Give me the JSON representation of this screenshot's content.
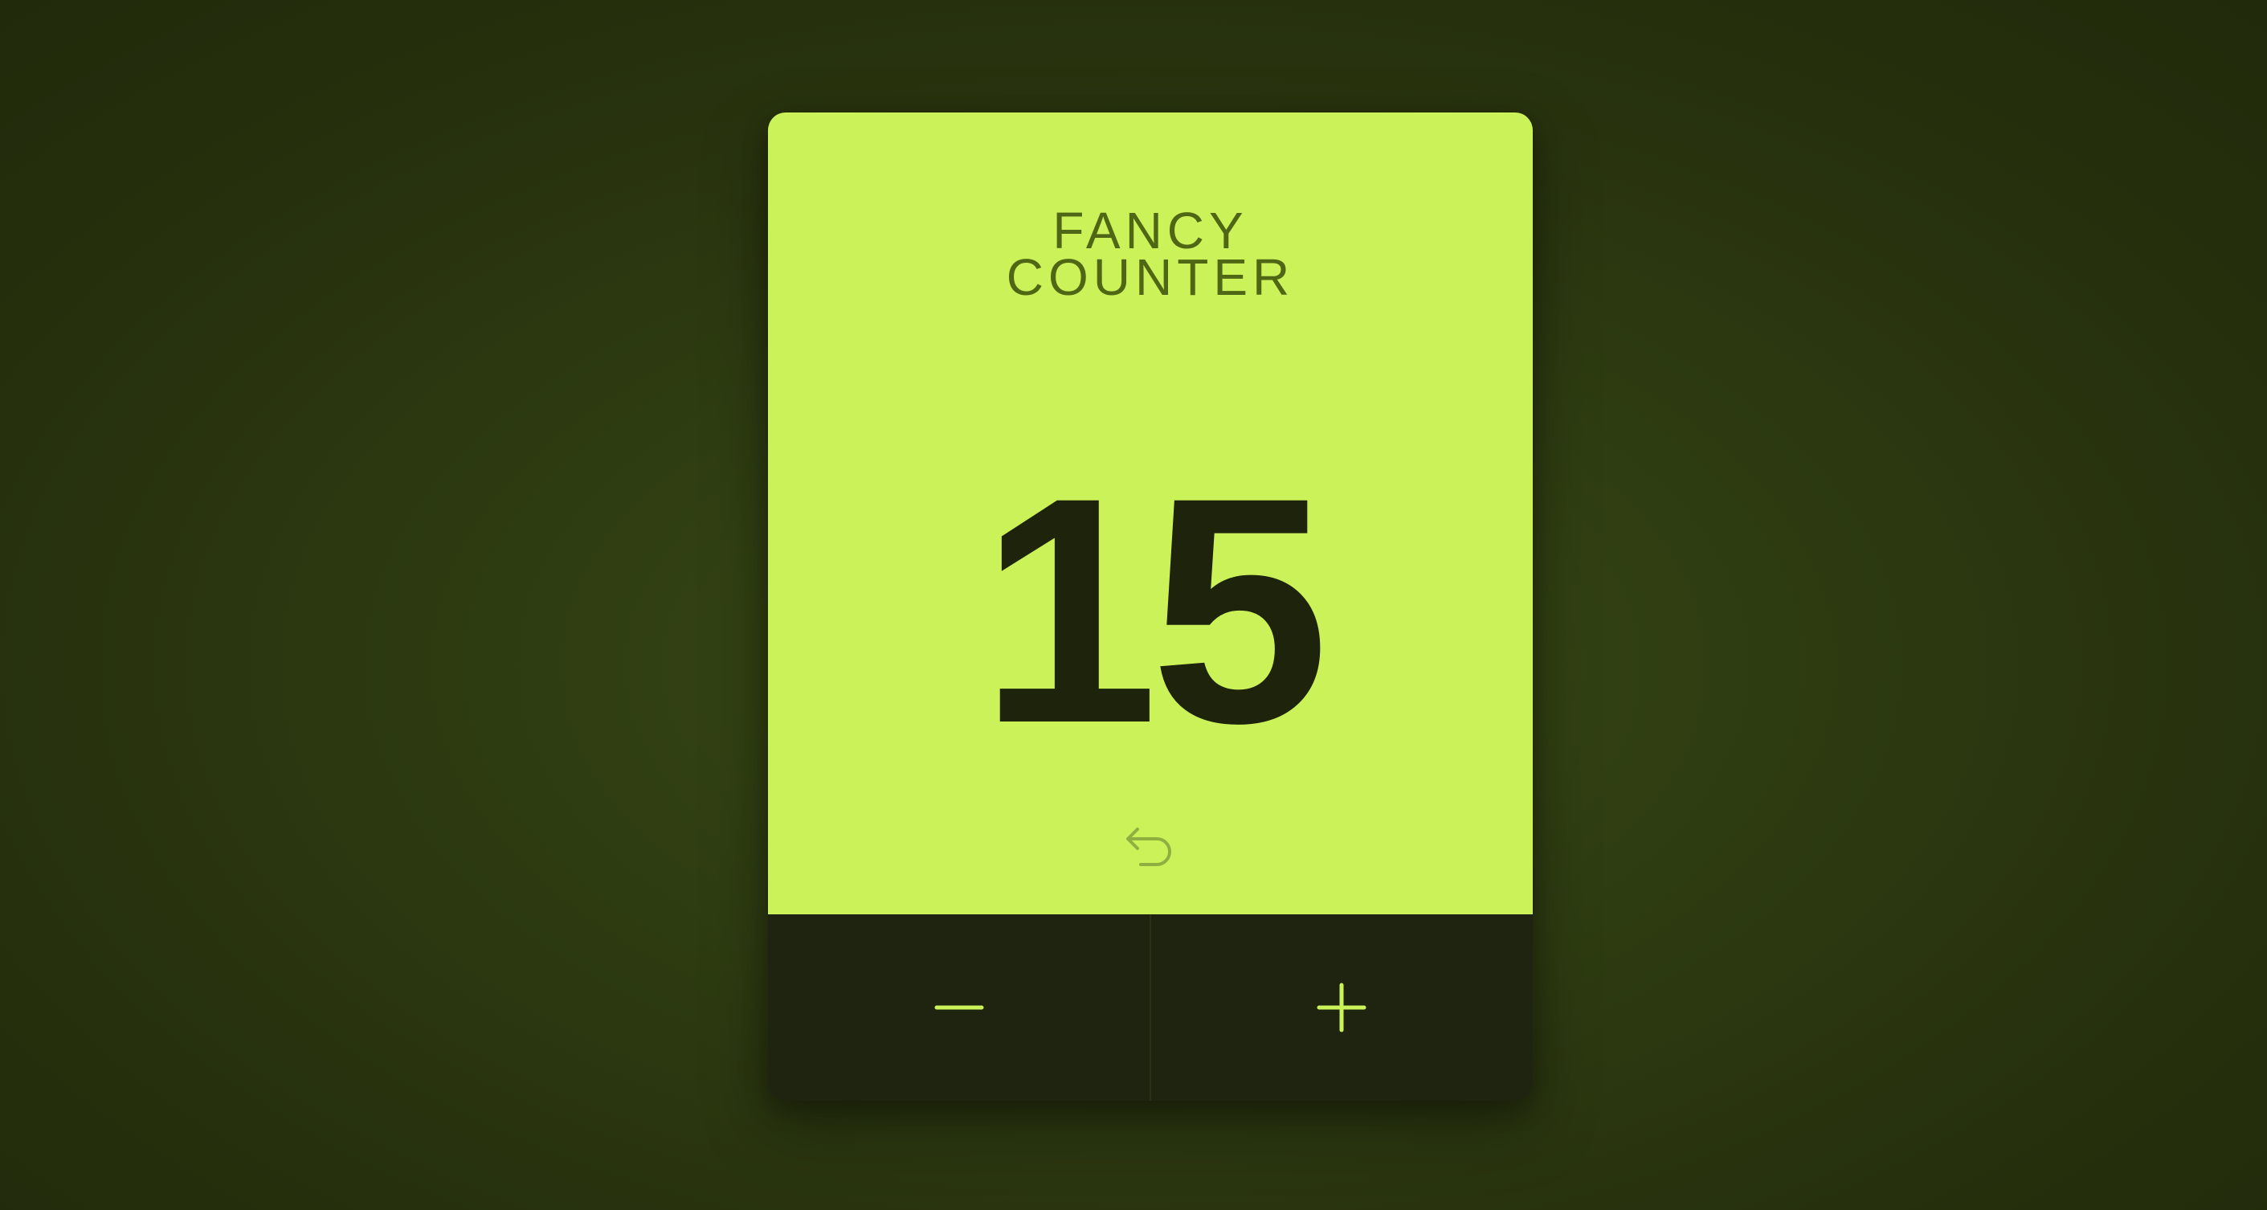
{
  "app": {
    "title_line1": "FANCY",
    "title_line2": "COUNTER"
  },
  "counter": {
    "value": "15"
  },
  "controls": {
    "reset_icon": "undo-arrow-icon",
    "decrement_icon": "minus-icon",
    "increment_icon": "plus-icon"
  },
  "colors": {
    "accent": "#ccf25a",
    "dark": "#1f2410",
    "title": "#4f6614",
    "number": "#1e240b"
  }
}
